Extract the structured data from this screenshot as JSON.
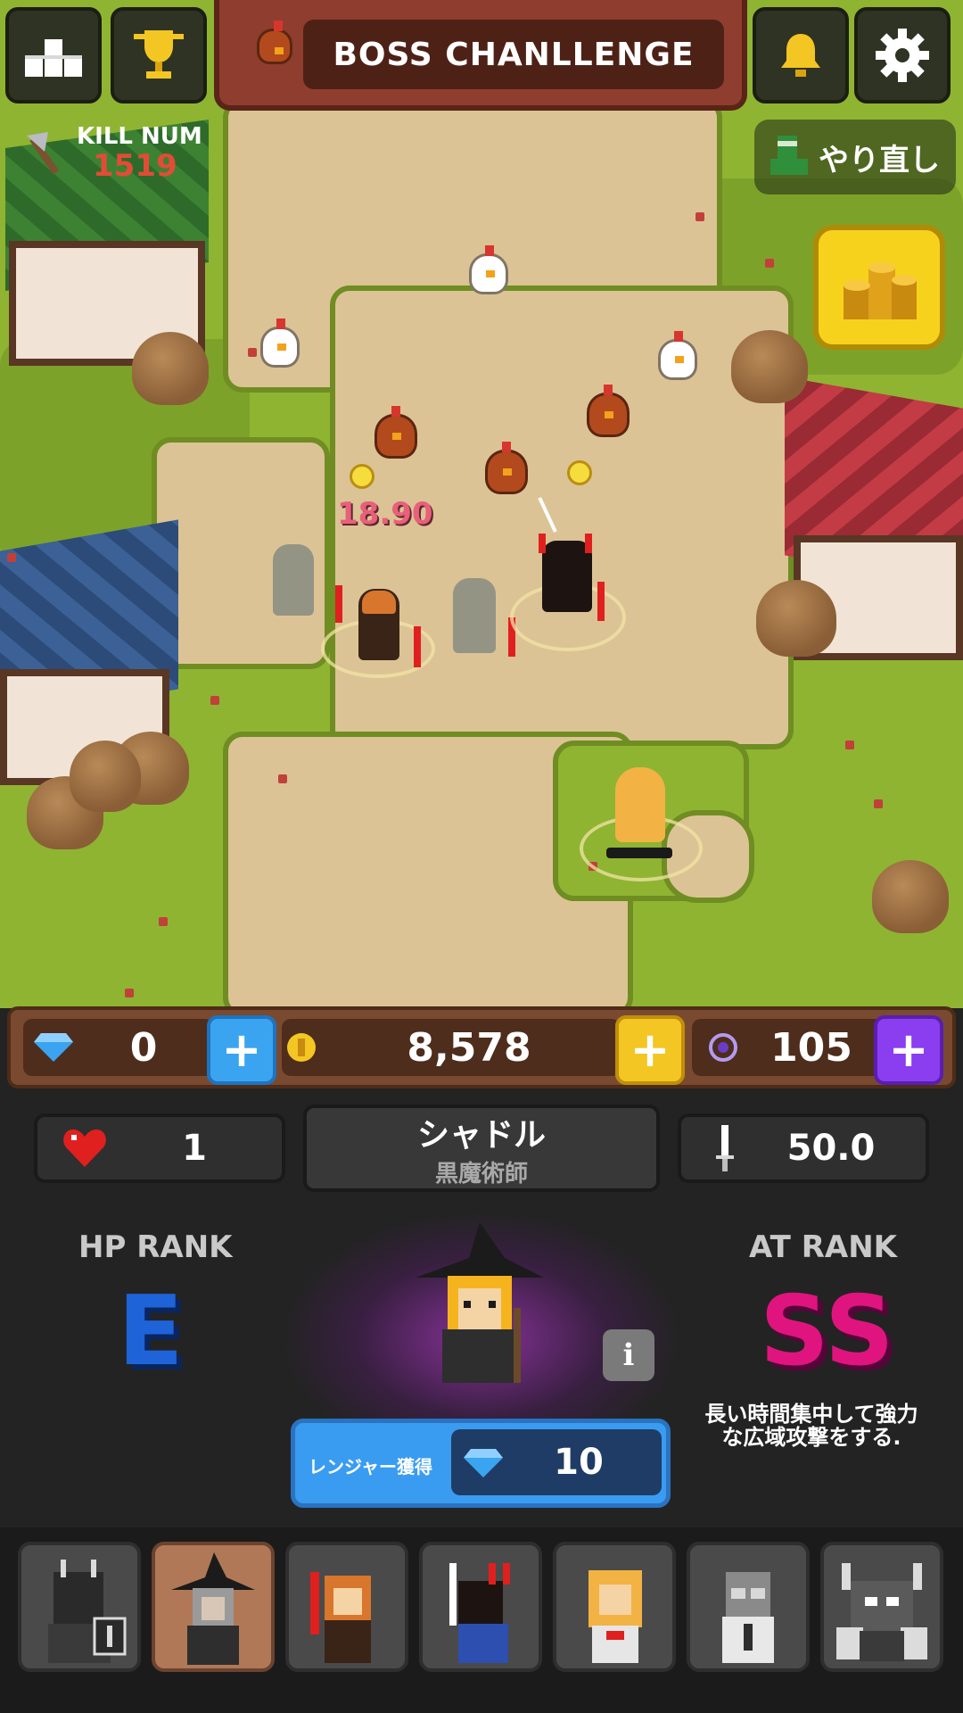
{
  "header": {
    "boss_title": "BOSS CHANLLENGE",
    "kill_label": "KILL NUM",
    "kill_count": "1519",
    "redo_label": "やり直し"
  },
  "icons": {
    "top_left": [
      "podium-icon",
      "trophy-icon"
    ],
    "top_right": [
      "bell-icon",
      "gear-icon"
    ],
    "banner": "chicken-icon",
    "coin_pile": "gold-coins-icon"
  },
  "battle": {
    "damage_text": "18.90"
  },
  "currency": {
    "gems": "0",
    "gold": "8,578",
    "orbs": "105",
    "plus_symbol": "+"
  },
  "stats": {
    "hp": "1",
    "character_name": "シャドル",
    "character_class": "黒魔術師",
    "attack": "50.0"
  },
  "ranks": {
    "hp_label": "HP RANK",
    "hp_value": "E",
    "at_label": "AT RANK",
    "at_value": "SS"
  },
  "description": "長い時間集中して強力な広域攻撃をする.",
  "info_label": "i",
  "acquire": {
    "label": "レンジャー獲得",
    "cost": "10"
  },
  "colors": {
    "grass": "#8fb432",
    "path": "#dcc395",
    "gem_plus": "#3aa4f0",
    "gold_plus": "#f3c623",
    "orb_plus": "#8a3ef0",
    "hp_rank": "#1e63d8",
    "at_rank": "#e0147e",
    "selected_slot": "#b07856"
  },
  "roster": [
    {
      "name": "dark-knight",
      "selected": false,
      "locked": true
    },
    {
      "name": "black-mage",
      "selected": true,
      "locked": false
    },
    {
      "name": "red-sword-girl",
      "selected": false,
      "locked": false
    },
    {
      "name": "horned-swordsman",
      "selected": false,
      "locked": false
    },
    {
      "name": "blonde-ranger",
      "selected": false,
      "locked": false
    },
    {
      "name": "scientist",
      "selected": false,
      "locked": true
    },
    {
      "name": "horned-robot",
      "selected": false,
      "locked": true
    }
  ]
}
